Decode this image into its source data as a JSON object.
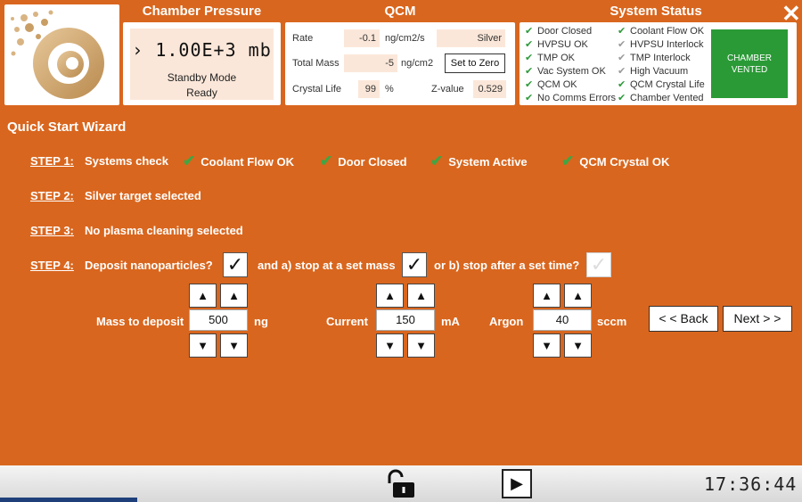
{
  "pressure": {
    "title": "Chamber Pressure",
    "reading": "› 1.00E+3 mb",
    "mode": "Standby Mode",
    "state": "Ready"
  },
  "qcm": {
    "title": "QCM",
    "rate_label": "Rate",
    "rate_value": "-0.1",
    "rate_unit": "ng/cm2/s",
    "material": "Silver",
    "mass_label": "Total Mass",
    "mass_value": "-5",
    "mass_unit": "ng/cm2",
    "zero_button": "Set to Zero",
    "life_label": "Crystal Life",
    "life_value": "99",
    "life_unit": "%",
    "zvalue_label": "Z-value",
    "zvalue": "0.529"
  },
  "status": {
    "title": "System Status",
    "left": [
      {
        "label": "Door Closed",
        "ok": true
      },
      {
        "label": "HVPSU OK",
        "ok": true
      },
      {
        "label": "TMP OK",
        "ok": true
      },
      {
        "label": "Vac System OK",
        "ok": true
      },
      {
        "label": "QCM OK",
        "ok": true
      },
      {
        "label": "No Comms Errors",
        "ok": true
      }
    ],
    "right": [
      {
        "label": "Coolant Flow OK",
        "ok": true
      },
      {
        "label": "HVPSU Interlock",
        "ok": false
      },
      {
        "label": "TMP Interlock",
        "ok": false
      },
      {
        "label": "High Vacuum",
        "ok": false
      },
      {
        "label": "QCM Crystal Life",
        "ok": true
      },
      {
        "label": "Chamber Vented",
        "ok": true
      }
    ],
    "vented_line1": "CHAMBER",
    "vented_line2": "VENTED"
  },
  "wizard": {
    "title": "Quick Start Wizard",
    "step1": {
      "label": "STEP 1:",
      "text": "Systems check",
      "checks": [
        "Coolant Flow OK",
        "Door Closed",
        "System Active",
        "QCM Crystal OK"
      ]
    },
    "step2": {
      "label": "STEP 2:",
      "text": "Silver target selected"
    },
    "step3": {
      "label": "STEP 3:",
      "text": "No plasma cleaning selected"
    },
    "step4": {
      "label": "STEP 4:",
      "text": "Deposit nanoparticles?",
      "opt_a": "and a) stop at a set mass",
      "opt_b": "or b) stop after a set time?"
    },
    "mass_label": "Mass to deposit",
    "mass_value": "500",
    "mass_unit": "ng",
    "current_label": "Current",
    "current_value": "150",
    "current_unit": "mA",
    "argon_label": "Argon",
    "argon_value": "40",
    "argon_unit": "sccm",
    "back_button": "< < Back",
    "next_button": "Next > >"
  },
  "footer": {
    "clock": "17:36:44"
  },
  "colors": {
    "background": "#D9661E",
    "ok_green": "#2E9A3A",
    "vented_green": "#2A9A36"
  }
}
